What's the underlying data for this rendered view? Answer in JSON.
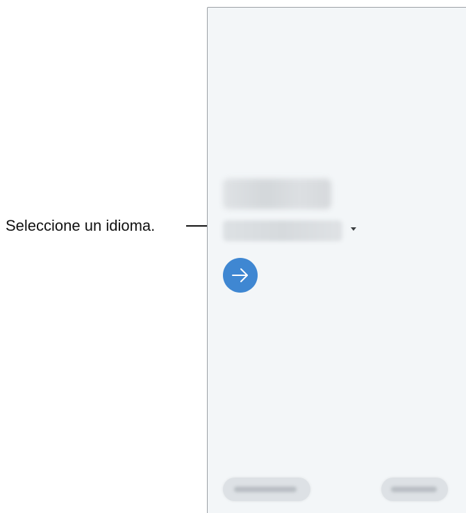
{
  "callout": {
    "label": "Seleccione un idioma."
  },
  "screen": {
    "next_button": {
      "icon": "arrow-right-icon",
      "color": "#3f87d2"
    },
    "dropdown_icon": "chevron-down-icon",
    "background": "#f3f6f8"
  }
}
